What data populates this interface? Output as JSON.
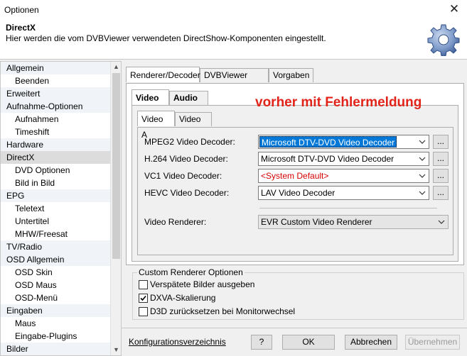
{
  "window": {
    "title": "Optionen"
  },
  "header": {
    "title": "DirectX",
    "subtitle": "Hier werden die vom DVBViewer verwendeten DirectShow-Komponenten eingestellt."
  },
  "sidebar": {
    "items": [
      {
        "label": "Allgemein",
        "kind": "cat"
      },
      {
        "label": "Beenden",
        "kind": "sub"
      },
      {
        "label": "Erweitert",
        "kind": "cat"
      },
      {
        "label": "Aufnahme-Optionen",
        "kind": "cat"
      },
      {
        "label": "Aufnahmen",
        "kind": "sub"
      },
      {
        "label": "Timeshift",
        "kind": "sub"
      },
      {
        "label": "Hardware",
        "kind": "cat"
      },
      {
        "label": "DirectX",
        "kind": "cat",
        "selected": true
      },
      {
        "label": "DVD Optionen",
        "kind": "sub"
      },
      {
        "label": "Bild in Bild",
        "kind": "sub"
      },
      {
        "label": "EPG",
        "kind": "cat"
      },
      {
        "label": "Teletext",
        "kind": "sub"
      },
      {
        "label": "Untertitel",
        "kind": "sub"
      },
      {
        "label": "MHW/Freesat",
        "kind": "sub"
      },
      {
        "label": "TV/Radio",
        "kind": "cat"
      },
      {
        "label": "OSD Allgemein",
        "kind": "cat"
      },
      {
        "label": "OSD Skin",
        "kind": "sub"
      },
      {
        "label": "OSD Maus",
        "kind": "sub"
      },
      {
        "label": "OSD-Menü",
        "kind": "sub"
      },
      {
        "label": "Eingaben",
        "kind": "cat"
      },
      {
        "label": "Maus",
        "kind": "sub"
      },
      {
        "label": "Eingabe-Plugins",
        "kind": "sub"
      },
      {
        "label": "Bilder",
        "kind": "cat"
      }
    ]
  },
  "tabs": {
    "main": [
      "Renderer/Decoder",
      "DVBViewer Filter",
      "Vorgaben"
    ],
    "media": [
      "Video",
      "Audio"
    ],
    "video": [
      "Video A",
      "Video B"
    ]
  },
  "annotation": "vorher mit Fehlermeldung",
  "decoders": [
    {
      "label": "MPEG2 Video Decoder:",
      "value": "Microsoft DTV-DVD Video Decoder",
      "style": "highlight",
      "more": "..."
    },
    {
      "label": "H.264 Video Decoder:",
      "value": "Microsoft DTV-DVD Video Decoder",
      "style": "normal",
      "more": "..."
    },
    {
      "label": "VC1 Video Decoder:",
      "value": "<System Default>",
      "style": "red",
      "more": "..."
    },
    {
      "label": "HEVC Video Decoder:",
      "value": "LAV Video Decoder",
      "style": "normal",
      "more": "..."
    }
  ],
  "renderer": {
    "label": "Video Renderer:",
    "value": "EVR Custom Video Renderer"
  },
  "custom_renderer": {
    "title": "Custom Renderer Optionen",
    "options": [
      {
        "label": "Verspätete Bilder ausgeben",
        "checked": false
      },
      {
        "label": "DXVA-Skalierung",
        "checked": true
      },
      {
        "label": "D3D zurücksetzen bei Monitorwechsel",
        "checked": false
      }
    ]
  },
  "footer": {
    "link": "Konfigurationsverzeichnis",
    "help": "?",
    "ok": "OK",
    "cancel": "Abbrechen",
    "apply": "Übernehmen"
  }
}
